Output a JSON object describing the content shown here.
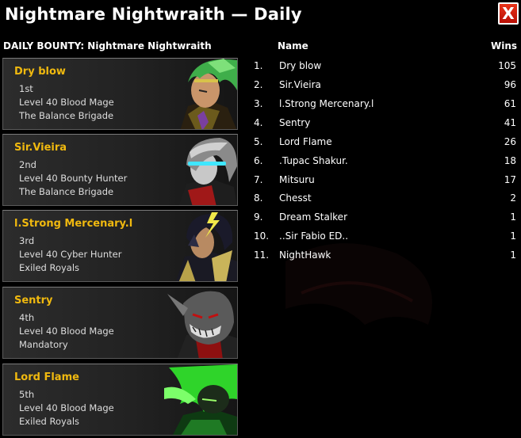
{
  "window": {
    "title": "Nightmare Nightwraith — Daily",
    "close_label": "X"
  },
  "bounty_label": "DAILY BOUNTY: Nightmare Nightwraith",
  "cards": [
    {
      "name": "Dry blow",
      "place": "1st",
      "level_class": "Level 40 Blood Mage",
      "guild": "The Balance Brigade",
      "portrait": "green-haired-hero-icon"
    },
    {
      "name": "Sir.Vieira",
      "place": "2nd",
      "level_class": "Level 40 Bounty Hunter",
      "guild": "The Balance Brigade",
      "portrait": "cyan-visor-hero-icon"
    },
    {
      "name": "l.Strong Mercenary.l",
      "place": "3rd",
      "level_class": "Level 40 Cyber Hunter",
      "guild": "Exiled Royals",
      "portrait": "lightning-horned-hero-icon"
    },
    {
      "name": "Sentry",
      "place": "4th",
      "level_class": "Level 40 Blood Mage",
      "guild": "Mandatory",
      "portrait": "grinning-demon-icon"
    },
    {
      "name": "Lord Flame",
      "place": "5th",
      "level_class": "Level 40 Blood Mage",
      "guild": "Exiled Royals",
      "portrait": "green-flame-hood-icon"
    }
  ],
  "table": {
    "headers": {
      "name": "Name",
      "wins": "Wins"
    },
    "rows": [
      {
        "rank": "1.",
        "name": "Dry blow",
        "wins": "105"
      },
      {
        "rank": "2.",
        "name": "Sir.Vieira",
        "wins": "96"
      },
      {
        "rank": "3.",
        "name": "l.Strong Mercenary.l",
        "wins": "61"
      },
      {
        "rank": "4.",
        "name": "Sentry",
        "wins": "41"
      },
      {
        "rank": "5.",
        "name": "Lord Flame",
        "wins": "26"
      },
      {
        "rank": "6.",
        "name": ".Tupac Shakur.",
        "wins": "18"
      },
      {
        "rank": "7.",
        "name": "Mitsuru",
        "wins": "17"
      },
      {
        "rank": "8.",
        "name": "Chesst",
        "wins": "2"
      },
      {
        "rank": "9.",
        "name": "Dream Stalker",
        "wins": "1"
      },
      {
        "rank": "10.",
        "name": "..Sir Fabio ED..",
        "wins": "1"
      },
      {
        "rank": "11.",
        "name": "NightHawk",
        "wins": "1"
      }
    ]
  },
  "colors": {
    "player_name": "#f0b90f",
    "close_red": "#d42410",
    "background": "#000000"
  }
}
